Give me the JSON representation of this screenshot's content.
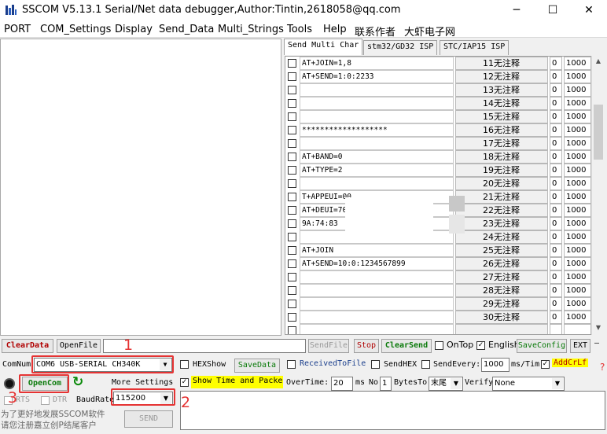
{
  "window": {
    "title": "SSCOM V5.13.1 Serial/Net data debugger,Author:Tintin,2618058@qq.com",
    "minimize": "─",
    "maximize": "☐",
    "close": "✕"
  },
  "menu": {
    "items": [
      "PORT",
      "COM_Settings",
      "Display",
      "Send_Data",
      "Multi_Strings",
      "Tools",
      "Help",
      "联系作者",
      "大虾电子网"
    ]
  },
  "tabs": [
    "Send Multi Char",
    "stm32/GD32 ISP",
    "STC/IAP15 ISP"
  ],
  "multi_rows": [
    {
      "cmd": "AT+JOIN=1,8",
      "num": "11",
      "note": "无注释",
      "order": "0",
      "delay": "1000"
    },
    {
      "cmd": "AT+SEND=1:0:2233",
      "num": "12",
      "note": "无注释",
      "order": "0",
      "delay": "1000"
    },
    {
      "cmd": "",
      "num": "13",
      "note": "无注释",
      "order": "0",
      "delay": "1000"
    },
    {
      "cmd": "",
      "num": "14",
      "note": "无注释",
      "order": "0",
      "delay": "1000"
    },
    {
      "cmd": "",
      "num": "15",
      "note": "无注释",
      "order": "0",
      "delay": "1000"
    },
    {
      "cmd": "*******************",
      "num": "16",
      "note": "无注释",
      "order": "0",
      "delay": "1000"
    },
    {
      "cmd": "",
      "num": "17",
      "note": "无注释",
      "order": "0",
      "delay": "1000"
    },
    {
      "cmd": "AT+BAND=0",
      "num": "18",
      "note": "无注释",
      "order": "0",
      "delay": "1000"
    },
    {
      "cmd": "AT+TYPE=2",
      "num": "19",
      "note": "无注释",
      "order": "0",
      "delay": "1000"
    },
    {
      "cmd": "",
      "num": "20",
      "note": "无注释",
      "order": "0",
      "delay": "1000"
    },
    {
      "cmd": "T+APPEUI=00",
      "num": "21",
      "note": "无注释",
      "order": "0",
      "delay": "1000"
    },
    {
      "cmd": "AT+DEUI=70",
      "num": "22",
      "note": "无注释",
      "order": "0",
      "delay": "1000"
    },
    {
      "cmd": "9A:74:83",
      "num": "23",
      "note": "无注释",
      "order": "0",
      "delay": "1000"
    },
    {
      "cmd": "",
      "num": "24",
      "note": "无注释",
      "order": "0",
      "delay": "1000"
    },
    {
      "cmd": "AT+JOIN",
      "num": "25",
      "note": "无注释",
      "order": "0",
      "delay": "1000"
    },
    {
      "cmd": "AT+SEND=10:0:1234567899",
      "num": "26",
      "note": "无注释",
      "order": "0",
      "delay": "1000"
    },
    {
      "cmd": "",
      "num": "27",
      "note": "无注释",
      "order": "0",
      "delay": "1000"
    },
    {
      "cmd": "",
      "num": "28",
      "note": "无注释",
      "order": "0",
      "delay": "1000"
    },
    {
      "cmd": "",
      "num": "29",
      "note": "无注释",
      "order": "0",
      "delay": "1000"
    },
    {
      "cmd": "",
      "num": "30",
      "note": "无注释",
      "order": "0",
      "delay": "1000"
    },
    {
      "cmd": "",
      "num": "",
      "note": "",
      "order": "",
      "delay": ""
    }
  ],
  "toolbar": {
    "clear_data": "ClearData",
    "open_file": "OpenFile",
    "send_file": "SendFile",
    "stop": "Stop",
    "clear_send": "ClearSend",
    "on_top": "OnTop",
    "english": "English",
    "save_config": "SaveConfig",
    "ext": "EXT",
    "dash": "—"
  },
  "settings": {
    "comnum_label": "ComNum",
    "com_port": "COM6 USB-SERIAL CH340K",
    "hexshow": "HEXShow",
    "save_data": "SaveData",
    "received_to_file": "ReceivedToFile",
    "send_hex": "SendHEX",
    "send_every": "SendEvery:",
    "send_every_value": "1000",
    "ms_tim": "ms/Tim",
    "add_crlf": "AddCrLf",
    "open_com": "OpenCom",
    "more_settings": "More Settings",
    "show_time": "Show Time and Packe",
    "overtime": "OverTime:",
    "overtime_value": "20",
    "ms": "ms",
    "no": "No",
    "no_value": "1",
    "bytes_to": "BytesTo",
    "bytes_to_value": "末尾",
    "verify": "Verify",
    "verify_value": "None",
    "rts": "RTS",
    "dtr": "DTR",
    "baudrate_label": "BaudRate",
    "baudrate": "115200",
    "promo_line1": "为了更好地发展SSCOM软件",
    "promo_line2": "请您注册嘉立创P结尾客户",
    "send": "SEND"
  },
  "annotations": {
    "n1": "1",
    "n2": "2",
    "n3": "3",
    "q": "?"
  },
  "colors": {
    "red": "#e53333",
    "green": "#0a8a0a",
    "highlight": "#ffff00"
  }
}
